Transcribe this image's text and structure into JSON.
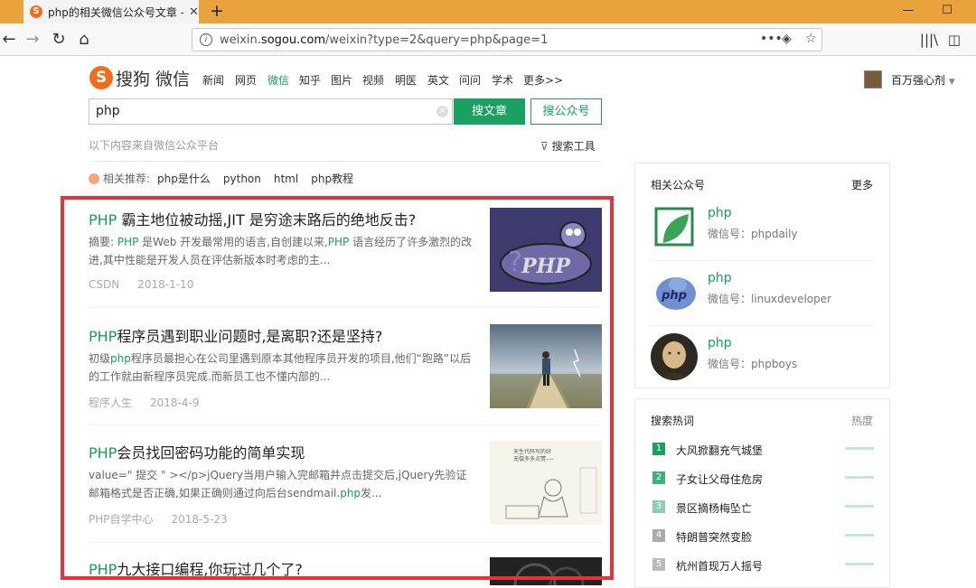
{
  "browser": {
    "tab_title": "php的相关微信公众号文章 – 搜",
    "tab_favicon": "S",
    "url_prefix": "weixin.",
    "url_host": "sogou.com",
    "url_path": "/weixin?type=2&query=php&page=1"
  },
  "header": {
    "logo_mark": "S",
    "logo_text": "搜狗",
    "logo_sub": "微信",
    "channels": [
      "新闻",
      "网页",
      "微信",
      "知乎",
      "图片",
      "视频",
      "明医",
      "英文",
      "问问",
      "学术",
      "更多>>"
    ],
    "active_channel": "微信",
    "username": "百万强心剂"
  },
  "search": {
    "query": "php",
    "btn_article": "搜文章",
    "btn_account": "搜公众号",
    "hint": "以下内容来自微信公众平台",
    "tools": "搜索工具",
    "related_label": "相关推荐:",
    "related": [
      "php是什么",
      "python",
      "html",
      "php教程"
    ]
  },
  "articles": [
    {
      "title_hl": "PHP",
      "title": " 霸主地位被动摇,JIT 是穷途末路后的绝地反击?",
      "summary": "摘要: PHP 是Web 开发最常用的语言,自创建以来,PHP 语言经历了许多激烈的改进,其中性能是开发人员在评估新版本时考虑的主...",
      "source": "CSDN",
      "date": "2018-1-10"
    },
    {
      "title_hl": "PHP",
      "title": "程序员遇到职业问题时,是离职?还是坚持?",
      "summary": "初级php程序员最担心在公司里遇到原本其他程序员开发的项目,他们“跑路”以后的工作就由新程序员完成.而新员工也不懂内部的...",
      "source": "程序人生",
      "date": "2018-4-9"
    },
    {
      "title_hl": "PHP",
      "title": "会员找回密码功能的简单实现",
      "summary": "value=\" 提交 \" ></p>jQuery当用户输入完邮箱并点击提交后,jQuery先验证邮箱格式是否正确,如果正确则通过向后台sendmail.php发...",
      "source": "PHP自学中心",
      "date": "2018-5-23"
    },
    {
      "title_hl": "PHP",
      "title": "九大接口编程,你玩过几个了?",
      "summary": "",
      "source": "",
      "date": ""
    }
  ],
  "related_accounts": {
    "title": "相关公众号",
    "more": "更多",
    "items": [
      {
        "name": "php",
        "id": "微信号：phpdaily"
      },
      {
        "name": "php",
        "id": "微信号：linuxdeveloper"
      },
      {
        "name": "php",
        "id": "微信号：phpboys"
      }
    ]
  },
  "hot": {
    "title": "搜索热词",
    "col": "热度",
    "items": [
      "大风掀翻充气城堡",
      "子女让父母住危房",
      "景区摘杨梅坠亡",
      "特朗普突然变脸",
      "杭州首现万人摇号"
    ],
    "colors": [
      "#1aa061",
      "#3eb07a",
      "#8ccfae",
      "#aaaaaa",
      "#bbbbbb"
    ]
  }
}
